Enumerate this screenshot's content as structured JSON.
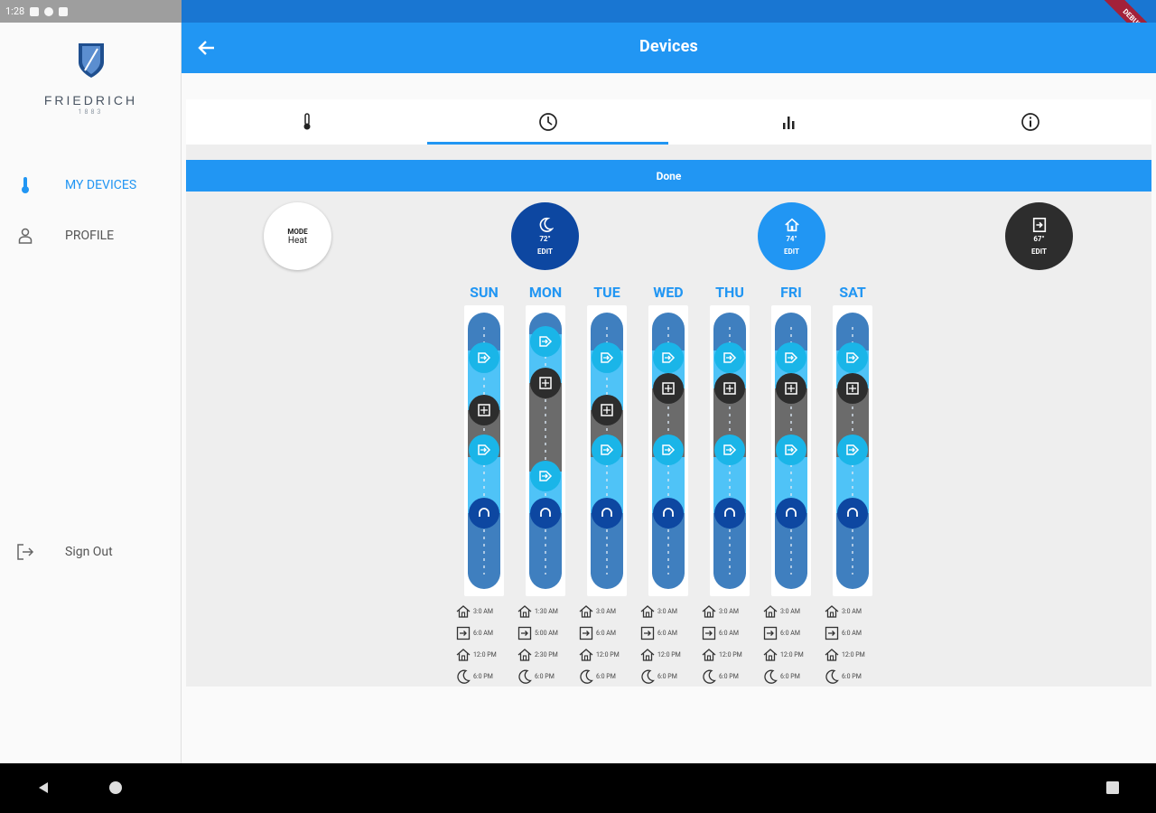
{
  "status": {
    "time": "1:28"
  },
  "ribbon": {
    "label": "DEBUG"
  },
  "brand": {
    "name": "FRIEDRICH",
    "year": "1883"
  },
  "sidebar": {
    "items": [
      {
        "label": "MY DEVICES",
        "icon": "thermometer-icon",
        "active": true
      },
      {
        "label": "PROFILE",
        "icon": "person-icon",
        "active": false
      }
    ],
    "signout": {
      "label": "Sign Out",
      "icon": "logout-icon"
    }
  },
  "appbar": {
    "title": "Devices"
  },
  "tabs": [
    {
      "icon": "thermometer-icon"
    },
    {
      "icon": "clock-icon",
      "active": true
    },
    {
      "icon": "bar-chart-icon"
    },
    {
      "icon": "info-icon"
    }
  ],
  "done_label": "Done",
  "mode": {
    "label": "MODE",
    "value": "Heat"
  },
  "presets": {
    "sleep": {
      "temp": "72°",
      "edit": "EDIT",
      "color": "#0d47a1"
    },
    "home": {
      "temp": "74°",
      "edit": "EDIT",
      "color": "#2196f3"
    },
    "away": {
      "temp": "67°",
      "edit": "EDIT",
      "color": "#2d2d2d"
    }
  },
  "days": [
    {
      "label": "SUN",
      "times": [
        "3:0 AM",
        "6:0 AM",
        "12:0 PM",
        "6:0 PM"
      ]
    },
    {
      "label": "MON",
      "times": [
        "1:30 AM",
        "5:00 AM",
        "2:30 PM",
        "6:0 PM"
      ]
    },
    {
      "label": "TUE",
      "times": [
        "3:0 AM",
        "6:0 AM",
        "12:0 PM",
        "6:0 PM"
      ]
    },
    {
      "label": "WED",
      "times": [
        "3:0 AM",
        "6:0 AM",
        "12:0 PM",
        "6:0 PM"
      ]
    },
    {
      "label": "THU",
      "times": [
        "3:0 AM",
        "6:0 AM",
        "12:0 PM",
        "6:0 PM"
      ]
    },
    {
      "label": "FRI",
      "times": [
        "3:0 AM",
        "6:0 AM",
        "12:0 PM",
        "6:0 PM"
      ]
    },
    {
      "label": "SAT",
      "times": [
        "3:0 AM",
        "6:0 AM",
        "12:0 PM",
        "6:0 PM"
      ]
    }
  ],
  "colors": {
    "accent": "#2196f3",
    "dark_blue": "#0d47a1",
    "cyan": "#1ab5e8",
    "dark": "#2d2d2d"
  }
}
